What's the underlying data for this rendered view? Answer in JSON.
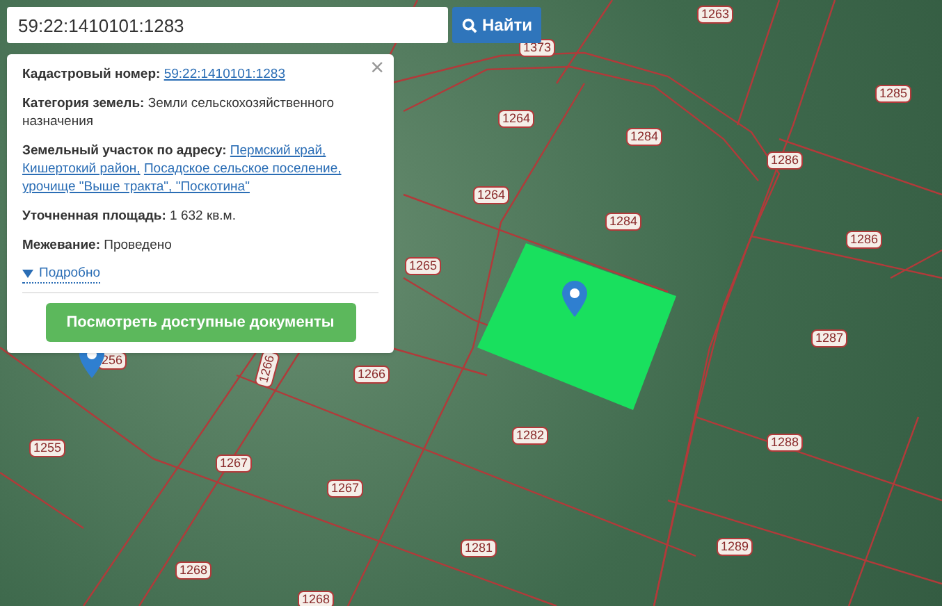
{
  "search": {
    "value": "59:22:1410101:1283",
    "button": "Найти"
  },
  "popup": {
    "close": "×",
    "fields": [
      {
        "kind": "link",
        "label": "Кадастровый номер:",
        "links": [
          "59:22:1410101:1283"
        ]
      },
      {
        "kind": "text",
        "label": "Категория земель:",
        "value": "Земли сельскохозяйственного назначения"
      },
      {
        "kind": "link",
        "label": "Земельный участок по адресу:",
        "links": [
          "Пермский край,",
          "Кишертокий район,",
          "Посадское сельское поселение,",
          "урочище \"Выше тракта\", \"Поскотина\""
        ]
      },
      {
        "kind": "text",
        "label": "Уточненная площадь:",
        "value": "1 632 кв.м."
      },
      {
        "kind": "text",
        "label": "Межевание:",
        "value": "Проведено"
      }
    ],
    "details": {
      "label": "Подробно",
      "expanded": false
    },
    "button": "Посмотреть доступные документы"
  },
  "map": {
    "parcel_labels": [
      "1263",
      "1373",
      "1285",
      "1264",
      "1284",
      "1286",
      "1264",
      "1284",
      "1286",
      "1265",
      "1287",
      "256",
      "1266",
      "1266",
      "1255",
      "1267",
      "1282",
      "1288",
      "1267",
      "1281",
      "1289",
      "1268",
      "1268"
    ]
  }
}
